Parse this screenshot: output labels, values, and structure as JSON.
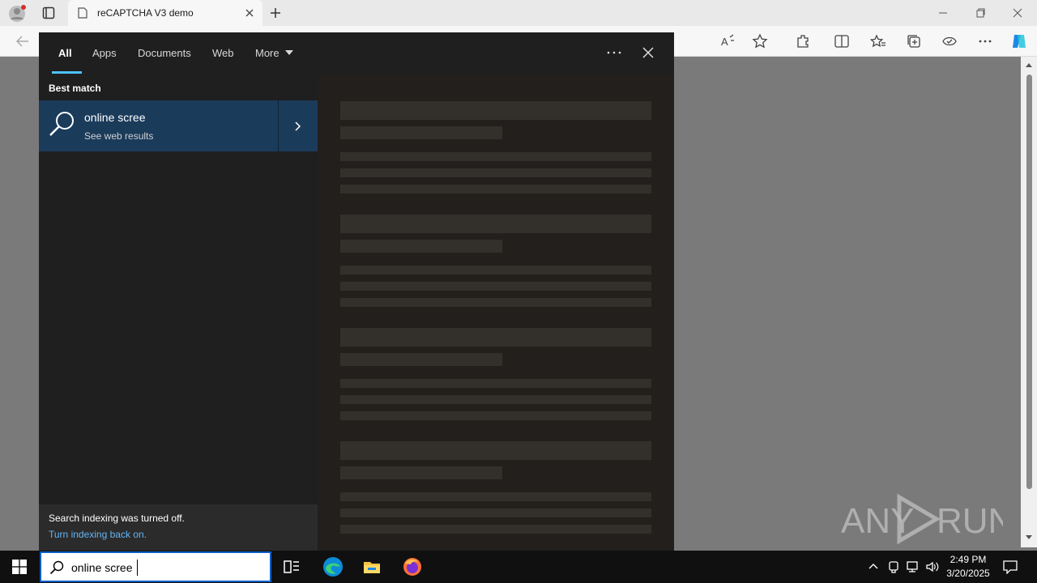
{
  "browser": {
    "tab_title": "reCAPTCHA V3 demo"
  },
  "search": {
    "tabs": [
      {
        "label": "All"
      },
      {
        "label": "Apps"
      },
      {
        "label": "Documents"
      },
      {
        "label": "Web"
      },
      {
        "label": "More"
      }
    ],
    "best_match_label": "Best match",
    "best_match": {
      "title": "online scree",
      "subtitle": "See web results"
    },
    "indexing_message": "Search indexing was turned off.",
    "indexing_link": "Turn indexing back on."
  },
  "taskbar": {
    "search_value": "online scree",
    "time": "2:49 PM",
    "date": "3/20/2025"
  },
  "watermark": {
    "text": "ANY RUN"
  },
  "colors": {
    "accent": "#4cc2ff",
    "best_match_bg": "#1b3b5b",
    "search_border": "#0a5fc6",
    "link": "#64b5f6"
  }
}
